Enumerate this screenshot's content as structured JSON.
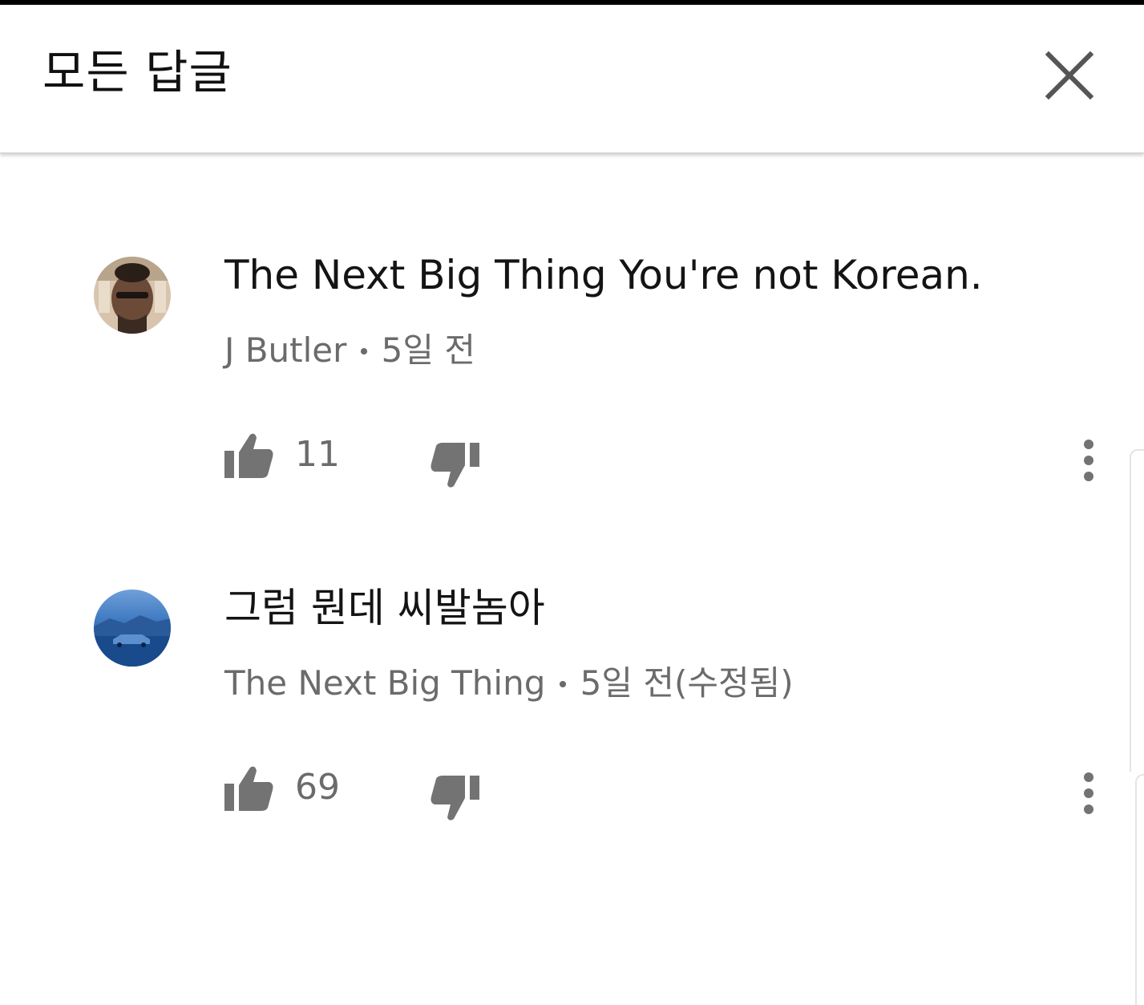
{
  "header": {
    "title": "모든 답글",
    "close_icon": "close-icon"
  },
  "comments": [
    {
      "text": "The Next Big Thing You're not Korean.",
      "author": "J Butler",
      "separator": "•",
      "time": "5일 전",
      "likes": "11",
      "avatar_colors": [
        "#c9b49a",
        "#3a2a22"
      ]
    },
    {
      "text": "그럼 뭔데 씨발놈아",
      "author": "The Next Big Thing",
      "separator": "•",
      "time": "5일 전(수정됨)",
      "likes": "69",
      "avatar_colors": [
        "#3a78c4",
        "#12305f"
      ]
    }
  ],
  "colors": {
    "text_primary": "#141414",
    "text_secondary": "#6b6b6b",
    "icon": "#737373"
  }
}
